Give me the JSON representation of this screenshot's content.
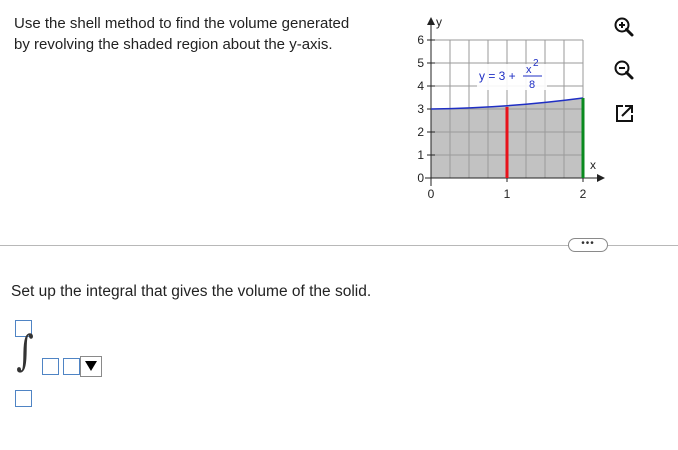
{
  "problem": {
    "line1": "Use the shell method to find the volume generated",
    "line2": "by revolving the shaded region about the y-axis."
  },
  "graph": {
    "y_axis_label": "y",
    "x_axis_label": "x",
    "y_ticks": [
      "6",
      "5",
      "4",
      "3",
      "2",
      "1",
      "0"
    ],
    "x_ticks": [
      "0",
      "1",
      "2"
    ],
    "equation_lhs": "y = 3 +",
    "equation_num": "x",
    "equation_exp": "2",
    "equation_den": "8",
    "curve_color": "#1f2fc4",
    "region_fill": "#c2c2c2",
    "red_line_color": "#e8121b",
    "green_line_color": "#0a8a1f"
  },
  "tools": {
    "zoom_in_icon": "zoom-in-icon",
    "zoom_out_icon": "zoom-out-icon",
    "popout_icon": "popout-icon"
  },
  "more_button": {
    "label": "•••"
  },
  "question": {
    "prompt": "Set up the integral that gives the volume of the solid.",
    "integral_symbol": "∫",
    "upper_limit": "",
    "lower_limit": "",
    "integrand": "",
    "dropdown_selected": ""
  }
}
